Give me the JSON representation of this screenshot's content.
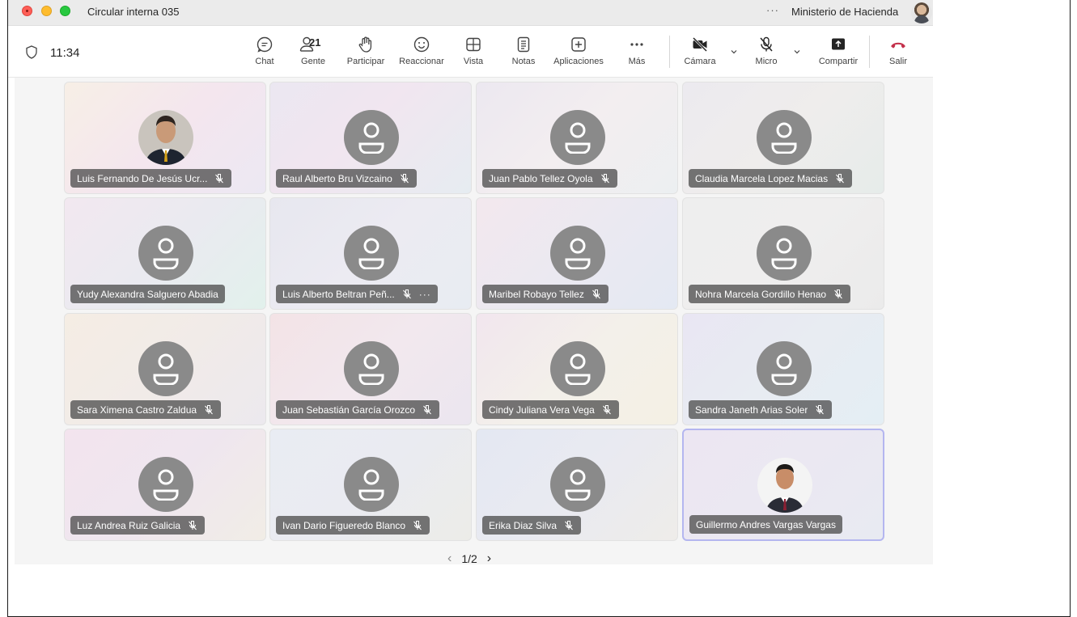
{
  "window": {
    "title": "Circular interna 035",
    "more": "···",
    "org_name": "Ministerio de Hacienda"
  },
  "toolbar": {
    "clock": "11:34",
    "people_count": "21",
    "buttons": {
      "chat": "Chat",
      "people": "Gente",
      "raise": "Participar",
      "react": "Reaccionar",
      "view": "Vista",
      "notes": "Notas",
      "apps": "Aplicaciones",
      "more": "Más",
      "camera": "Cámara",
      "mic": "Micro",
      "share": "Compartir",
      "leave": "Salir"
    },
    "colors": {
      "leave": "#c4314b"
    }
  },
  "participants": [
    {
      "name": "Luis Fernando De Jesús Ucr...",
      "muted": true,
      "photo": true,
      "more": false,
      "bg": "linear-gradient(135deg,#f7efe6,#f4e6ee 50%,#ece8f3)"
    },
    {
      "name": "Raul Alberto Bru Vizcaino",
      "muted": true,
      "photo": false,
      "more": false,
      "bg": "linear-gradient(135deg,#ebe7f1,#f1e6f0 45%,#e6ecf1)"
    },
    {
      "name": "Juan Pablo Tellez Oyola",
      "muted": true,
      "photo": false,
      "more": false,
      "bg": "linear-gradient(135deg,#ece8f0,#f3eef0 50%,#eceff1)"
    },
    {
      "name": "Claudia Marcela Lopez Macias",
      "muted": true,
      "photo": false,
      "more": false,
      "bg": "linear-gradient(135deg,#eceaef,#efedec 50%,#e6ecea)"
    },
    {
      "name": "Yudy Alexandra Salguero Abadia",
      "muted": false,
      "photo": false,
      "more": false,
      "bg": "linear-gradient(135deg,#f2e8f0,#eaeaf0 50%,#e2f1ec)"
    },
    {
      "name": "Luis Alberto Beltran Peñ...",
      "muted": true,
      "photo": false,
      "more": true,
      "bg": "linear-gradient(135deg,#e7e7ef,#ecebf2 50%,#e8ecf2)"
    },
    {
      "name": "Maribel Robayo Tellez",
      "muted": true,
      "photo": false,
      "more": false,
      "bg": "linear-gradient(135deg,#f3e8ee,#ebe9f1 50%,#e4e9f3)"
    },
    {
      "name": "Nohra Marcela Gordillo Henao",
      "muted": true,
      "photo": false,
      "more": false,
      "bg": "linear-gradient(135deg,#eeeeee,#efeeee 50%,#ebebeb)"
    },
    {
      "name": "Sara Ximena Castro Zaldua",
      "muted": true,
      "photo": false,
      "more": false,
      "bg": "linear-gradient(135deg,#f5ede4,#f1ebe8 50%,#ece9ee)"
    },
    {
      "name": "Juan Sebastián García Orozco",
      "muted": true,
      "photo": false,
      "more": false,
      "bg": "linear-gradient(135deg,#f3e3e6,#f2e8ee 50%,#ebe6ef)"
    },
    {
      "name": "Cindy Juliana Vera Vega",
      "muted": true,
      "photo": false,
      "more": false,
      "bg": "linear-gradient(135deg,#f2e6ee,#f3f0ea 50%,#f4f0e4)"
    },
    {
      "name": "Sandra Janeth Arias Soler",
      "muted": true,
      "photo": false,
      "more": false,
      "bg": "linear-gradient(135deg,#e9e6f3,#e8ecf2 50%,#e4eef4)"
    },
    {
      "name": "Luz Andrea Ruiz Galicia",
      "muted": true,
      "photo": false,
      "more": false,
      "bg": "linear-gradient(135deg,#f3e4ee,#efe6ef 50%,#f1ede6)"
    },
    {
      "name": "Ivan Dario Figueredo Blanco",
      "muted": true,
      "photo": false,
      "more": false,
      "bg": "linear-gradient(135deg,#e9ecf3,#eaebf1 50%,#ecece8)"
    },
    {
      "name": "Erika Diaz Silva",
      "muted": true,
      "photo": false,
      "more": false,
      "bg": "linear-gradient(135deg,#e4e8f2,#e9eaf1 50%,#eeece9)"
    },
    {
      "name": "Guillermo Andres Vargas Vargas",
      "muted": false,
      "photo": true,
      "more": false,
      "selected": true,
      "bg": "linear-gradient(135deg,#ece6f2,#ebe8f2 50%,#e8eaf2)"
    }
  ],
  "pager": {
    "label": "1/2"
  }
}
